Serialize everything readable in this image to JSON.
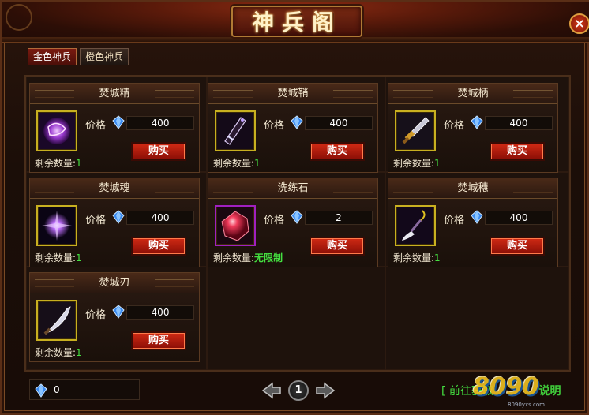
{
  "window": {
    "title": "神兵阁",
    "close_symbol": "×"
  },
  "tabs": [
    {
      "label": "金色神兵",
      "active": true
    },
    {
      "label": "橙色神兵",
      "active": false
    }
  ],
  "labels": {
    "price": "价格",
    "buy": "购买",
    "remaining": "剩余数量:"
  },
  "items": [
    {
      "name": "焚城精",
      "price": "400",
      "remaining": "1",
      "icon": "purple-orb-icon"
    },
    {
      "name": "焚城鞘",
      "price": "400",
      "remaining": "1",
      "icon": "dark-scabbard-icon"
    },
    {
      "name": "焚城柄",
      "price": "400",
      "remaining": "1",
      "icon": "blade-hilt-icon"
    },
    {
      "name": "焚城魂",
      "price": "400",
      "remaining": "1",
      "icon": "purple-spark-icon"
    },
    {
      "name": "洗练石",
      "price": "2",
      "remaining": "无限制",
      "icon": "red-gem-icon"
    },
    {
      "name": "焚城穗",
      "price": "400",
      "remaining": "1",
      "icon": "tassel-icon"
    },
    {
      "name": "焚城刃",
      "price": "400",
      "remaining": "1",
      "icon": "curved-blade-icon"
    }
  ],
  "footer": {
    "gem_balance": "0",
    "current_page": "1",
    "help_link": "[ 前往获取",
    "watermark": "8090",
    "watermark_tail": "说明",
    "watermark_sub": "8090yxs.com"
  },
  "colors": {
    "remaining_green": "#44e040",
    "buy_button": "#c0200e",
    "gold_frame": "#c8b020",
    "purple_frame": "#a020c0"
  }
}
